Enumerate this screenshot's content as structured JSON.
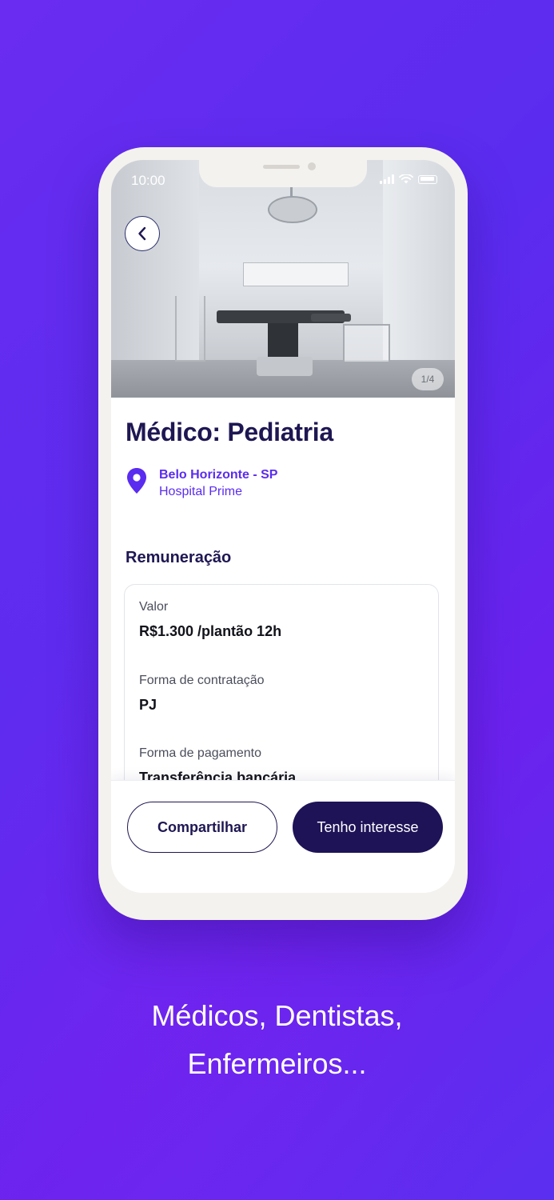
{
  "status_bar": {
    "time": "10:00"
  },
  "photo": {
    "counter": "1/4"
  },
  "job": {
    "title": "Médico: Pediatria",
    "city": "Belo Horizonte - SP",
    "hospital": "Hospital Prime"
  },
  "remuneration": {
    "section_title": "Remuneração",
    "fields": [
      {
        "label": "Valor",
        "value": "R$1.300 /plantão 12h"
      },
      {
        "label": "Forma de contratação",
        "value": "PJ"
      },
      {
        "label": "Forma de pagamento",
        "value": "Transferência bancária"
      }
    ]
  },
  "actions": {
    "share_label": "Compartilhar",
    "interest_label": "Tenho interesse"
  },
  "caption": {
    "line1": "Médicos, Dentistas,",
    "line2": "Enfermeiros..."
  },
  "colors": {
    "background": "#5a2cef",
    "primary_dark": "#1e1357",
    "accent": "#5a2cef"
  },
  "icons": {
    "back": "chevron-left-icon",
    "location": "map-pin-icon"
  }
}
